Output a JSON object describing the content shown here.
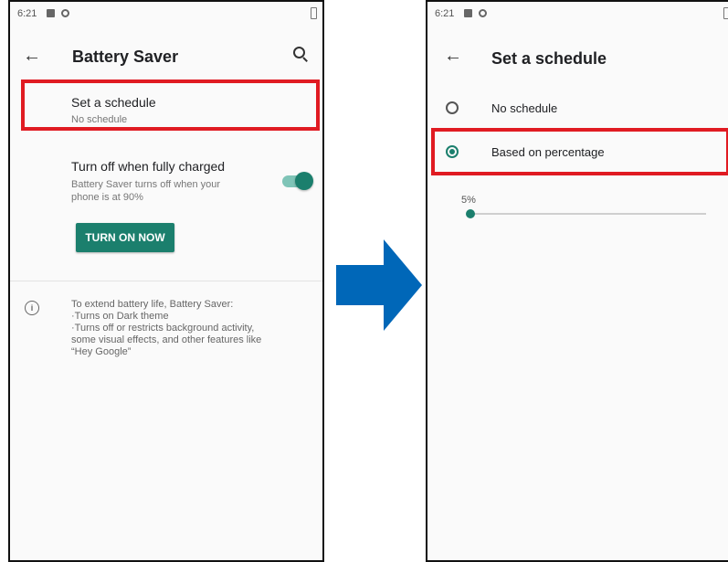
{
  "colors": {
    "accent": "#1b7f6d",
    "highlight": "#e01b22",
    "arrow": "#0067b8"
  },
  "left_screen": {
    "status": {
      "time": "6:21"
    },
    "appbar": {
      "title": "Battery Saver",
      "back_icon": "arrow-left-icon",
      "search_icon": "search-icon"
    },
    "schedule": {
      "title": "Set a schedule",
      "subtitle": "No schedule"
    },
    "fully_charged": {
      "title": "Turn off when fully charged",
      "subtitle": "Battery Saver turns off when your\nphone is at 90%",
      "toggle_on": true
    },
    "turn_on_button": "TURN ON NOW",
    "info": {
      "icon": "info-icon",
      "text": "To extend battery life, Battery Saver:\n·Turns on Dark theme\n·Turns off or restricts background activity,\nsome visual effects, and other features like\n“Hey Google”"
    }
  },
  "right_screen": {
    "status": {
      "time": "6:21"
    },
    "appbar": {
      "title": "Set a schedule",
      "back_icon": "arrow-left-icon"
    },
    "options": [
      {
        "label": "No schedule",
        "selected": false
      },
      {
        "label": "Based on percentage",
        "selected": true
      }
    ],
    "slider": {
      "label": "5%",
      "value_percent": 5
    }
  }
}
